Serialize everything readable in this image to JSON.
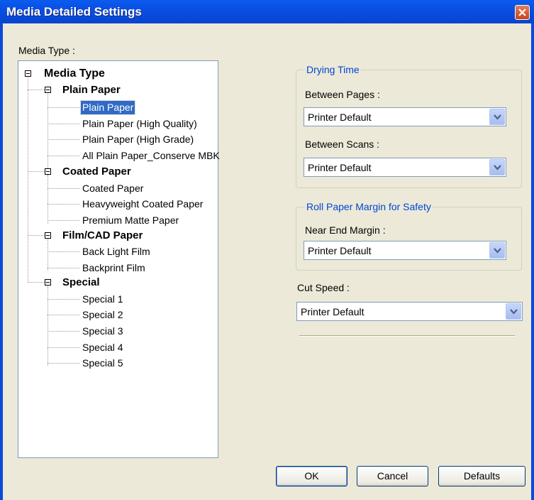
{
  "window": {
    "title": "Media Detailed Settings"
  },
  "media_type_label": "Media Type :",
  "tree": {
    "root": "Media Type",
    "groups": [
      {
        "label": "Plain Paper",
        "items": [
          "Plain Paper",
          "Plain Paper (High Quality)",
          "Plain Paper (High Grade)",
          "All Plain Paper_Conserve MBK"
        ]
      },
      {
        "label": "Coated Paper",
        "items": [
          "Coated Paper",
          "Heavyweight Coated Paper",
          "Premium Matte Paper"
        ]
      },
      {
        "label": "Film/CAD Paper",
        "items": [
          "Back Light Film",
          "Backprint Film"
        ]
      },
      {
        "label": "Special",
        "items": [
          "Special 1",
          "Special 2",
          "Special 3",
          "Special 4",
          "Special 5"
        ]
      }
    ],
    "selected": "Plain Paper"
  },
  "drying_time": {
    "legend": "Drying Time",
    "between_pages_label": "Between Pages :",
    "between_pages_value": "Printer Default",
    "between_scans_label": "Between Scans :",
    "between_scans_value": "Printer Default"
  },
  "roll_margin": {
    "legend": "Roll Paper Margin for Safety",
    "near_end_label": "Near End Margin :",
    "near_end_value": "Printer Default"
  },
  "cut_speed": {
    "label": "Cut Speed :",
    "value": "Printer Default"
  },
  "buttons": {
    "ok": "OK",
    "cancel": "Cancel",
    "defaults": "Defaults"
  },
  "colors": {
    "title_bar": "#0a4fe2",
    "face": "#ece9d8",
    "legend": "#0046d5",
    "selection": "#316ac5"
  }
}
